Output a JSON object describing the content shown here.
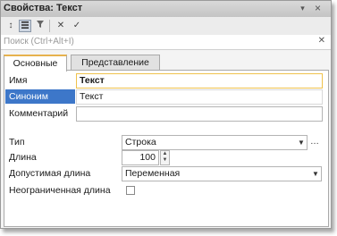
{
  "window": {
    "title": "Свойства: Текст"
  },
  "titlebar": {
    "menu_glyph": "▾",
    "close_glyph": "×"
  },
  "toolbar": {
    "sort_glyph": "↕",
    "cancel_glyph": "✕",
    "check_glyph": "✓"
  },
  "search": {
    "placeholder": "Поиск (Ctrl+Alt+I)",
    "clear_glyph": "✕"
  },
  "tabs": [
    {
      "label": "Основные"
    },
    {
      "label": "Представление"
    }
  ],
  "form": {
    "name_label": "Имя",
    "name_value": "Текст",
    "synonym_label": "Синоним",
    "synonym_value": "Текст",
    "comment_label": "Комментарий",
    "comment_value": "",
    "type_label": "Тип",
    "type_value": "Строка",
    "length_label": "Длина",
    "length_value": "100",
    "allowed_length_label": "Допустимая длина",
    "allowed_length_value": "Переменная",
    "unlimited_label": "Неограниченная длина"
  },
  "colors": {
    "selection": "#3d77c9",
    "focus_border": "#f0c24c",
    "annotation": "#e01010",
    "active_tab_accent": "#e6b24e"
  }
}
